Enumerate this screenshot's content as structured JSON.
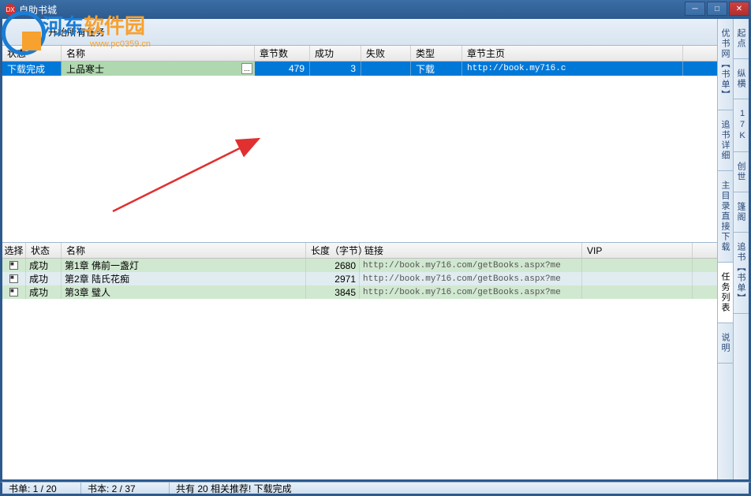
{
  "titlebar": {
    "app_icon_text": "DX",
    "title": "自助书城"
  },
  "watermark": {
    "text_blue": "河东",
    "text_orange": "软件园",
    "url": "www.pc0359.cn"
  },
  "toolbar": {
    "start_all": "开始所有任务"
  },
  "top_grid": {
    "headers": {
      "status": "状态",
      "name": "名称",
      "chapters": "章节数",
      "success": "成功",
      "fail": "失败",
      "type": "类型",
      "url": "章节主页"
    },
    "rows": [
      {
        "status": "下载完成",
        "name": "上品寒士",
        "chapters": "479",
        "success": "3",
        "fail": "",
        "type": "下载",
        "url": "http://book.my716.c"
      }
    ]
  },
  "bottom_grid": {
    "headers": {
      "select": "选择",
      "status": "状态",
      "name": "名称",
      "length": "长度（字节）",
      "link": "链接",
      "vip": "VIP"
    },
    "rows": [
      {
        "checked": true,
        "status": "成功",
        "name": "第1章 佛前一盏灯",
        "length": "2680",
        "link": "http://book.my716.com/getBooks.aspx?me",
        "vip": ""
      },
      {
        "checked": true,
        "status": "成功",
        "name": "第2章 陆氏花痴",
        "length": "2971",
        "link": "http://book.my716.com/getBooks.aspx?me",
        "vip": ""
      },
      {
        "checked": true,
        "status": "成功",
        "name": "第3章 璧人",
        "length": "3845",
        "link": "http://book.my716.com/getBooks.aspx?me",
        "vip": ""
      }
    ]
  },
  "right_sidebar_1": {
    "tabs": [
      "优书网【书单】",
      "追书详细",
      "主目录直接下载",
      "任务列表",
      "说明"
    ]
  },
  "right_sidebar_2": {
    "tabs": [
      "起点",
      "纵横",
      "17K",
      "创世",
      "篷阁",
      "追书【书单】"
    ]
  },
  "statusbar": {
    "book_list": "书单: 1 / 20",
    "book": "书本: 2 / 37",
    "message": "共有 20 相关推荐! 下载完成"
  }
}
